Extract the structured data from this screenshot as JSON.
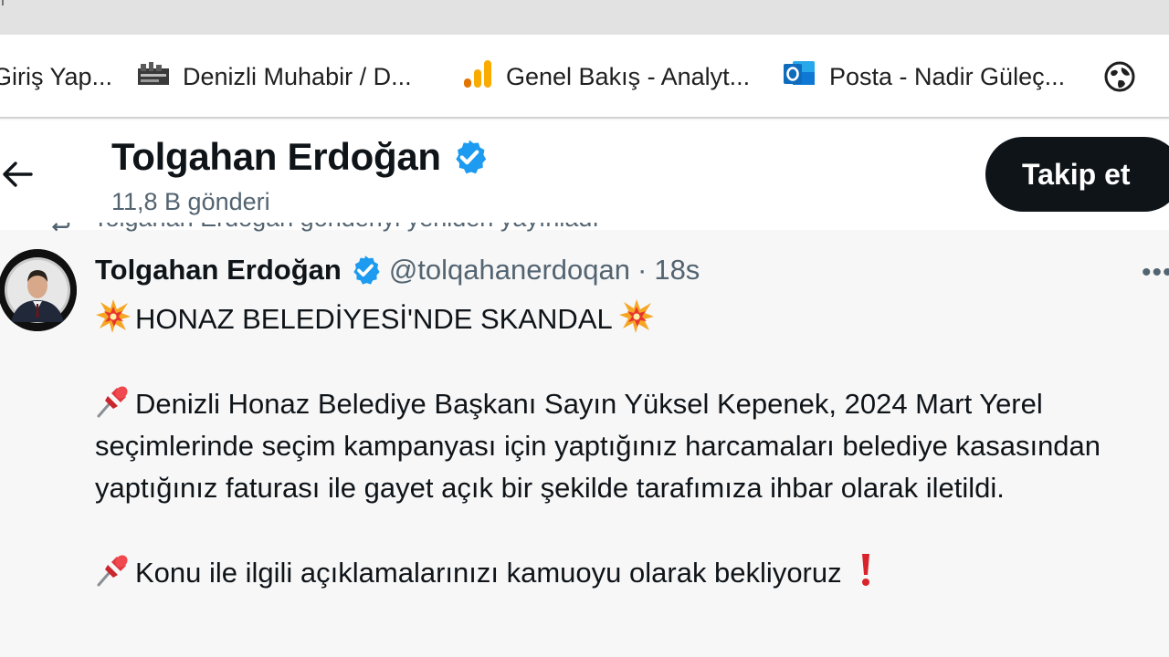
{
  "bookmarks": [
    {
      "label": "Giriş Yap...",
      "icon": "bookmark-generic-icon"
    },
    {
      "label": "Denizli Muhabir / D...",
      "icon": "newspaper-favicon-icon"
    },
    {
      "label": "Genel Bakış - Analyt...",
      "icon": "analytics-bars-icon"
    },
    {
      "label": "Posta - Nadir Güleç...",
      "icon": "outlook-icon"
    }
  ],
  "header": {
    "name": "Tolgahan Erdoğan",
    "post_count": "11,8 B gönderi",
    "follow_label": "Takip et"
  },
  "repost_notice": "Tolgahan Erdoğan gönderiyi yeniden yayınladı",
  "tweet": {
    "name": "Tolgahan Erdoğan",
    "handle": "@tolqahanerdoqan",
    "dot": "·",
    "time": "18s",
    "more": "•••",
    "title": "HONAZ BELEDİYESİ'NDE SKANDAL",
    "paragraph1": "Denizli Honaz Belediye Başkanı Sayın Yüksel Kepenek, 2024 Mart Yerel seçimlerinde seçim kampanyası için yaptığınız harcamaları belediye kasasından yaptığınız faturası ile gayet açık bir şekilde tarafımıza ihbar olarak iletildi.",
    "paragraph2": "Konu ile ilgili açıklamalarınızı kamuoyu olarak bekliyoruz"
  },
  "colors": {
    "verified": "#1d9bf0",
    "follow_bg": "#0f1419",
    "secondary_text": "#536471",
    "analytics_orange": "#f9ab00",
    "outlook_blue": "#0f6cbd"
  }
}
